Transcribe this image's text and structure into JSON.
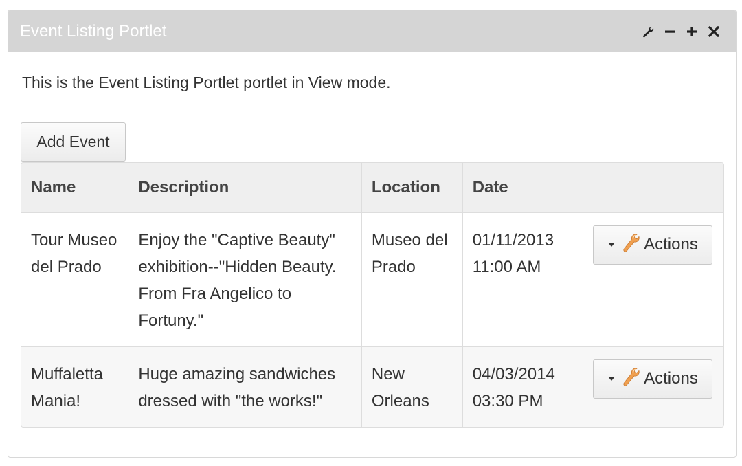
{
  "portlet": {
    "title": "Event Listing Portlet",
    "controls": [
      {
        "name": "configuration-icon",
        "icon": "wrench-icon"
      },
      {
        "name": "minimize-icon",
        "icon": "minus-icon"
      },
      {
        "name": "maximize-icon",
        "icon": "plus-icon"
      },
      {
        "name": "close-icon",
        "icon": "close-icon"
      }
    ]
  },
  "intro_text": "This is the Event Listing Portlet portlet in View mode.",
  "add_button_label": "Add Event",
  "table": {
    "headers": {
      "name": "Name",
      "description": "Description",
      "location": "Location",
      "date": "Date",
      "actions": ""
    },
    "rows": [
      {
        "name": "Tour Museo del Prado",
        "description": "Enjoy the \"Captive Beauty\" exhibition--\"Hidden Beauty. From Fra Angelico to Fortuny.\"",
        "location": "Museo del Prado",
        "date": "01/11/2013",
        "time": "11:00 AM",
        "actions_label": "Actions"
      },
      {
        "name": "Muffaletta Mania!",
        "description": "Huge amazing sandwiches dressed with \"the works!\"",
        "location": "New Orleans",
        "date": "04/03/2014",
        "time": "03:30 PM",
        "actions_label": "Actions"
      }
    ]
  },
  "colors": {
    "header_bg": "#d5d5d5",
    "header_text": "#ffffff",
    "table_header_bg": "#efefef",
    "accent_wrench": "#f0a050"
  }
}
